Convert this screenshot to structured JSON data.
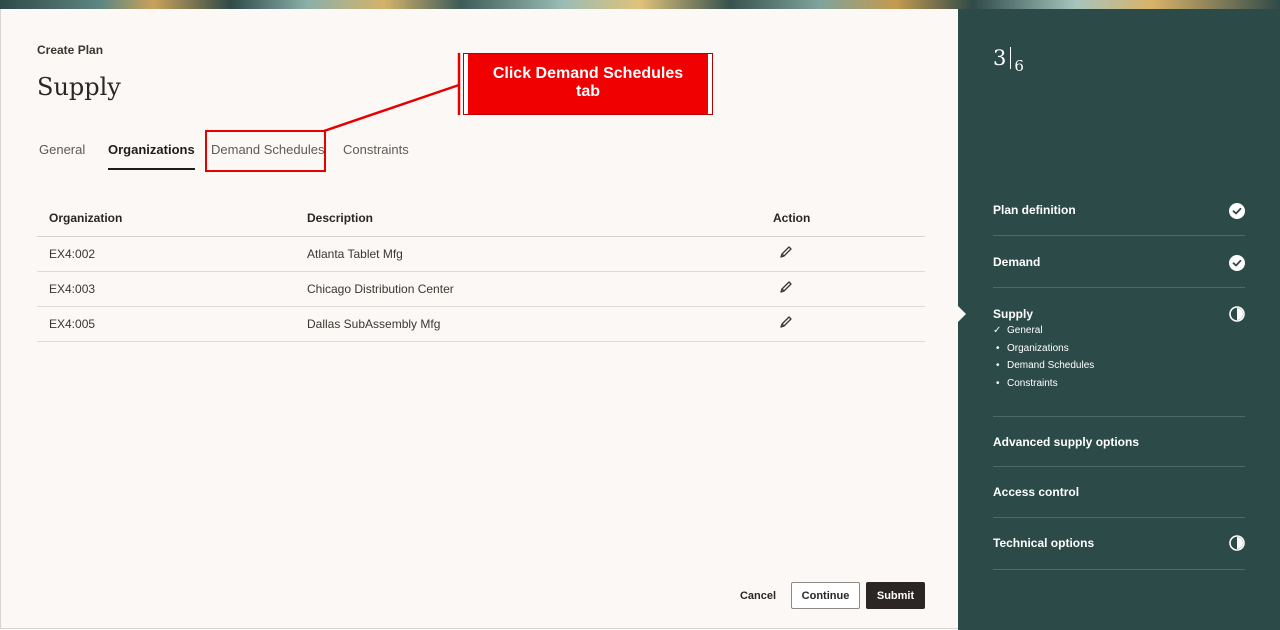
{
  "page": {
    "breadcrumb": "Create Plan",
    "title": "Supply"
  },
  "tabs": [
    {
      "label": "General",
      "active": false
    },
    {
      "label": "Organizations",
      "active": true
    },
    {
      "label": "Demand Schedules",
      "active": false
    },
    {
      "label": "Constraints",
      "active": false
    }
  ],
  "callout": {
    "line1": "Click Demand Schedules",
    "line2": "tab"
  },
  "table": {
    "headers": {
      "organization": "Organization",
      "description": "Description",
      "action": "Action"
    },
    "rows": [
      {
        "organization": "EX4:002",
        "description": "Atlanta Tablet Mfg",
        "action_icon": "pencil-icon"
      },
      {
        "organization": "EX4:003",
        "description": "Chicago Distribution Center",
        "action_icon": "pencil-icon"
      },
      {
        "organization": "EX4:005",
        "description": "Dallas SubAssembly Mfg",
        "action_icon": "pencil-icon"
      }
    ]
  },
  "buttons": {
    "cancel": "Cancel",
    "continue": "Continue",
    "submit": "Submit"
  },
  "sidebar": {
    "step_current": "3",
    "step_total": "6",
    "steps": [
      {
        "label": "Plan definition",
        "status": "complete",
        "status_icon": "check-circle-icon"
      },
      {
        "label": "Demand",
        "status": "complete",
        "status_icon": "check-circle-icon"
      },
      {
        "label": "Supply",
        "status": "in-progress",
        "status_icon": "half-circle-icon",
        "substeps": [
          {
            "label": "General",
            "marker": "✓"
          },
          {
            "label": "Organizations",
            "marker": "•"
          },
          {
            "label": "Demand Schedules",
            "marker": "•"
          },
          {
            "label": "Constraints",
            "marker": "•"
          }
        ]
      },
      {
        "label": "Advanced supply options",
        "status": "not-started",
        "status_icon": ""
      },
      {
        "label": "Access control",
        "status": "not-started",
        "status_icon": ""
      },
      {
        "label": "Technical options",
        "status": "in-progress",
        "status_icon": "half-circle-icon"
      }
    ]
  },
  "colors": {
    "sidebar_bg": "#2c4a48",
    "callout_red": "#f00000",
    "submit_bg": "#2b2623",
    "main_bg": "#fbf8f6"
  }
}
